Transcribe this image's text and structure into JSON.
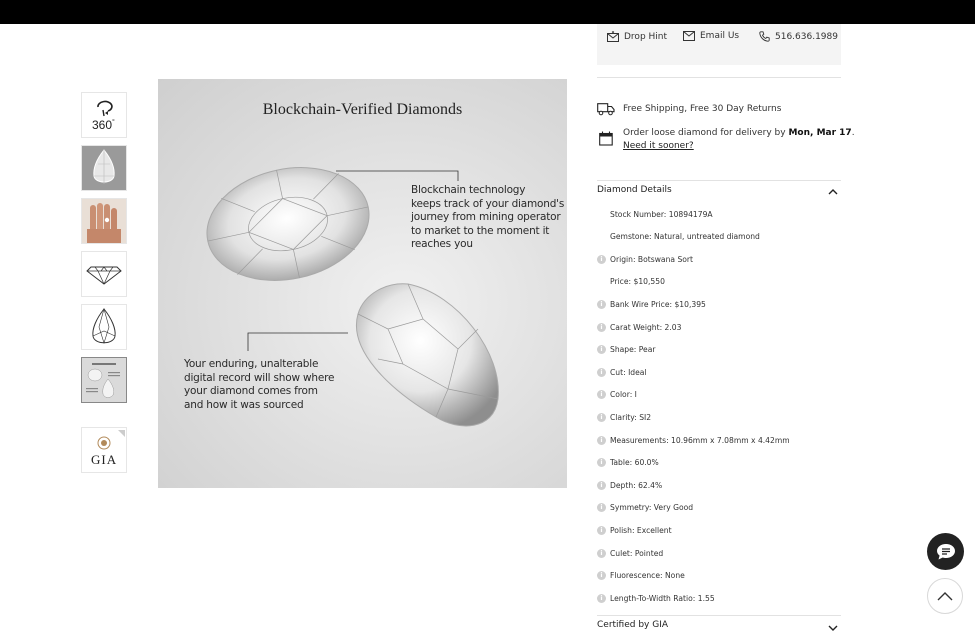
{
  "thumbnails": {
    "view_360_label": "360",
    "view_360_degree": "°",
    "gia_label": "GIA"
  },
  "hero": {
    "title": "Blockchain-Verified Diamonds",
    "text_right": [
      "Blockchain technology",
      "keeps track of your diamond's",
      "journey from mining operator",
      "to market to the moment it",
      "reaches you"
    ],
    "text_left": [
      "Your enduring, unalterable",
      "digital record will show where",
      "your diamond comes from",
      "and how it was sourced"
    ]
  },
  "contact": {
    "drop_hint": "Drop Hint",
    "email_us": "Email Us",
    "phone": "516.636.1989"
  },
  "shipping": {
    "free_shipping": "Free Shipping, Free 30 Day Returns",
    "delivery_prefix": "Order loose diamond for delivery by ",
    "delivery_date": "Mon, Mar 17",
    "delivery_suffix": ".",
    "need_sooner": "Need it sooner?"
  },
  "diamond_details": {
    "title": "Diamond Details",
    "rows": [
      {
        "text": "Stock Number: 10894179A",
        "info": false
      },
      {
        "text": "Gemstone: Natural, untreated diamond",
        "info": false
      },
      {
        "text": "Origin: Botswana Sort",
        "info": true
      },
      {
        "text": "Price: $10,550",
        "info": false
      },
      {
        "text": "Bank Wire Price: $10,395",
        "info": true
      },
      {
        "text": "Carat Weight: 2.03",
        "info": true
      },
      {
        "text": "Shape: Pear",
        "info": true
      },
      {
        "text": "Cut: Ideal",
        "info": true
      },
      {
        "text": "Color: I",
        "info": true
      },
      {
        "text": "Clarity: SI2",
        "info": true
      },
      {
        "text": "Measurements: 10.96mm x 7.08mm x 4.42mm",
        "info": true
      },
      {
        "text": "Table: 60.0%",
        "info": true
      },
      {
        "text": "Depth: 62.4%",
        "info": true
      },
      {
        "text": "Symmetry: Very Good",
        "info": true
      },
      {
        "text": "Polish: Excellent",
        "info": true
      },
      {
        "text": "Culet: Pointed",
        "info": true
      },
      {
        "text": "Fluorescence: None",
        "info": true
      },
      {
        "text": "Length-To-Width Ratio: 1.55",
        "info": true
      }
    ]
  },
  "certified": {
    "title": "Certified by GIA"
  },
  "info_glyph": "i",
  "colors": {
    "topbar": "#000000",
    "chat_button": "#222222",
    "info_icon": "#cfcfcf"
  }
}
